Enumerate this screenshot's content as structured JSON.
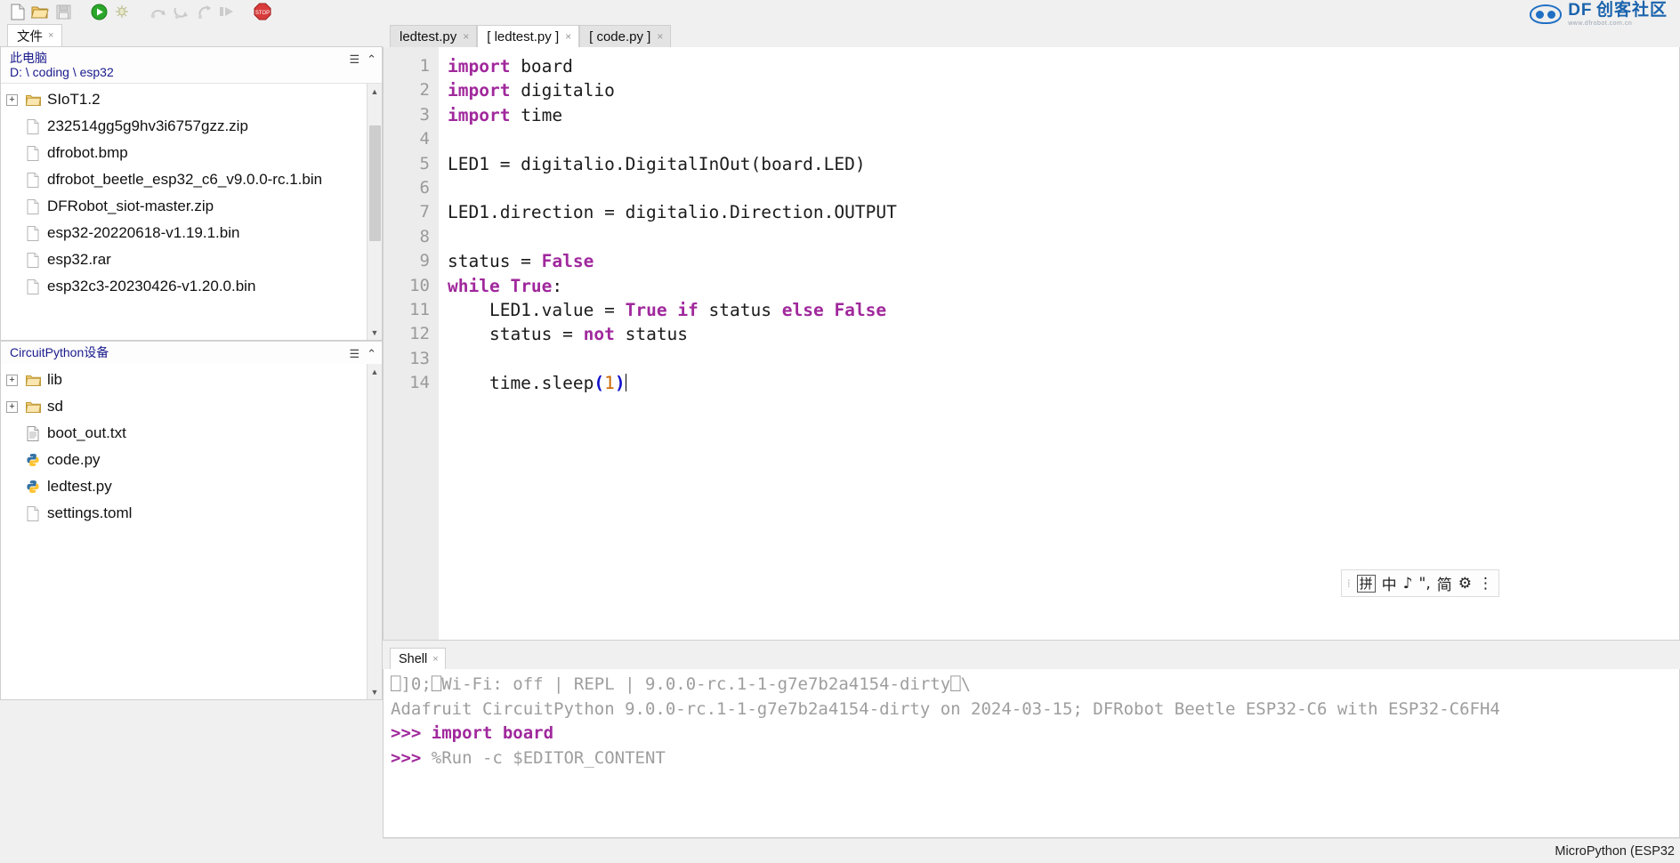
{
  "toolbar": {
    "buttons": [
      {
        "name": "new-file-button",
        "icon": "new-file-icon",
        "label": "New",
        "enabled": true
      },
      {
        "name": "open-file-button",
        "icon": "open-folder-icon",
        "label": "Open",
        "enabled": true
      },
      {
        "name": "save-file-button",
        "icon": "save-disk-icon",
        "label": "Save",
        "enabled": false
      },
      {
        "name": "run-button",
        "icon": "run-play-icon",
        "label": "Run",
        "enabled": true
      },
      {
        "name": "debug-button",
        "icon": "debug-bug-icon",
        "label": "Debug",
        "enabled": false
      },
      {
        "name": "step-over-button",
        "icon": "step-over-icon",
        "label": "Step over",
        "enabled": false
      },
      {
        "name": "step-into-button",
        "icon": "step-into-icon",
        "label": "Step into",
        "enabled": false
      },
      {
        "name": "step-out-button",
        "icon": "step-out-icon",
        "label": "Step out",
        "enabled": false
      },
      {
        "name": "resume-button",
        "icon": "resume-icon",
        "label": "Resume",
        "enabled": false
      },
      {
        "name": "stop-button",
        "icon": "stop-sign-icon",
        "label": "Stop",
        "enabled": true
      }
    ]
  },
  "brand": {
    "title": "DF",
    "subtitle": "创客社区",
    "tagline": "www.dfrobot.com.cn"
  },
  "left_pane": {
    "tab_label": "文件",
    "tab_close": "×",
    "files_panel": {
      "root_label": "此电脑",
      "path_label": "D: \\ coding \\ esp32",
      "menu_icon": "hamburger-menu-icon",
      "collapse_icon": "chevron-up-icon",
      "items": [
        {
          "name": "SIoT1.2",
          "type": "folder",
          "expandable": true
        },
        {
          "name": "232514gg5g9hv3i6757gzz.zip",
          "type": "file",
          "expandable": false
        },
        {
          "name": "dfrobot.bmp",
          "type": "file",
          "expandable": false
        },
        {
          "name": "dfrobot_beetle_esp32_c6_v9.0.0-rc.1.bin",
          "type": "file",
          "expandable": false
        },
        {
          "name": "DFRobot_siot-master.zip",
          "type": "file",
          "expandable": false
        },
        {
          "name": "esp32-20220618-v1.19.1.bin",
          "type": "file",
          "expandable": false
        },
        {
          "name": "esp32.rar",
          "type": "file",
          "expandable": false
        },
        {
          "name": "esp32c3-20230426-v1.20.0.bin",
          "type": "file",
          "expandable": false
        }
      ],
      "scroll_up": "⌃",
      "scroll_down": "⌄"
    },
    "device_panel": {
      "title": "CircuitPython设备",
      "menu_icon": "hamburger-menu-icon",
      "collapse_icon": "chevron-up-icon",
      "items": [
        {
          "name": "lib",
          "type": "folder",
          "expandable": true
        },
        {
          "name": "sd",
          "type": "folder",
          "expandable": true
        },
        {
          "name": "boot_out.txt",
          "type": "textfile",
          "expandable": false
        },
        {
          "name": "code.py",
          "type": "python",
          "expandable": false
        },
        {
          "name": "ledtest.py",
          "type": "python",
          "expandable": false
        },
        {
          "name": "settings.toml",
          "type": "file",
          "expandable": false
        }
      ],
      "scroll_up": "⌃",
      "scroll_down": "⌄"
    }
  },
  "editor": {
    "tabs": [
      {
        "label": "ledtest.py",
        "close": "×",
        "active": false
      },
      {
        "label": "[ ledtest.py ]",
        "close": "×",
        "active": true
      },
      {
        "label": "[ code.py ]",
        "close": "×",
        "active": false
      }
    ],
    "line_numbers": [
      "1",
      "2",
      "3",
      "4",
      "5",
      "6",
      "7",
      "8",
      "9",
      "10",
      "11",
      "12",
      "13",
      "14"
    ],
    "lines": [
      {
        "n": 1,
        "tokens": [
          {
            "t": "import",
            "c": "kw"
          },
          {
            "t": " board",
            "c": ""
          }
        ]
      },
      {
        "n": 2,
        "tokens": [
          {
            "t": "import",
            "c": "kw"
          },
          {
            "t": " digitalio",
            "c": ""
          }
        ]
      },
      {
        "n": 3,
        "tokens": [
          {
            "t": "import",
            "c": "kw"
          },
          {
            "t": " time",
            "c": ""
          }
        ]
      },
      {
        "n": 4,
        "tokens": []
      },
      {
        "n": 5,
        "tokens": [
          {
            "t": "LED1 = digitalio.DigitalInOut(board.LED)",
            "c": ""
          }
        ]
      },
      {
        "n": 6,
        "tokens": []
      },
      {
        "n": 7,
        "tokens": [
          {
            "t": "LED1.direction = digitalio.Direction.OUTPUT",
            "c": ""
          }
        ]
      },
      {
        "n": 8,
        "tokens": []
      },
      {
        "n": 9,
        "tokens": [
          {
            "t": "status = ",
            "c": ""
          },
          {
            "t": "False",
            "c": "kw"
          }
        ]
      },
      {
        "n": 10,
        "tokens": [
          {
            "t": "while",
            "c": "kw"
          },
          {
            "t": " ",
            "c": ""
          },
          {
            "t": "True",
            "c": "kw"
          },
          {
            "t": ":",
            "c": ""
          }
        ]
      },
      {
        "n": 11,
        "tokens": [
          {
            "t": "    LED1.value = ",
            "c": ""
          },
          {
            "t": "True",
            "c": "kw"
          },
          {
            "t": " ",
            "c": ""
          },
          {
            "t": "if",
            "c": "kw"
          },
          {
            "t": " status ",
            "c": ""
          },
          {
            "t": "else",
            "c": "kw"
          },
          {
            "t": " ",
            "c": ""
          },
          {
            "t": "False",
            "c": "kw"
          }
        ]
      },
      {
        "n": 12,
        "tokens": [
          {
            "t": "    status = ",
            "c": ""
          },
          {
            "t": "not",
            "c": "kw"
          },
          {
            "t": " status",
            "c": ""
          }
        ]
      },
      {
        "n": 13,
        "tokens": []
      },
      {
        "n": 14,
        "tokens": [
          {
            "t": "    time.sleep",
            "c": ""
          },
          {
            "t": "(",
            "c": "paren"
          },
          {
            "t": "1",
            "c": "num"
          },
          {
            "t": ")",
            "c": "paren"
          }
        ]
      }
    ]
  },
  "ime_toolbar": {
    "items": [
      "拼",
      "中",
      "♪",
      "\",",
      "简",
      "⚙",
      "⋮"
    ],
    "handle": "drag-handle"
  },
  "shell": {
    "tab_label": "Shell",
    "tab_close": "×",
    "lines": [
      {
        "kind": "out",
        "text": "⎕]0;⎕Wi-Fi: off | REPL | 9.0.0-rc.1-1-g7e7b2a4154-dirty⎕\\"
      },
      {
        "kind": "out",
        "text": "Adafruit CircuitPython 9.0.0-rc.1-1-g7e7b2a4154-dirty on 2024-03-15; DFRobot Beetle ESP32-C6 with ESP32-C6FH4"
      },
      {
        "kind": "prompt",
        "prompt": ">>>",
        "text": "import board",
        "style": "input"
      },
      {
        "kind": "prompt",
        "prompt": ">>>",
        "text": "%Run -c $EDITOR_CONTENT",
        "style": "echo"
      }
    ]
  },
  "status_bar": {
    "interpreter": "MicroPython (ESP32"
  },
  "colors": {
    "keyword": "#a0289c",
    "number": "#cc6600",
    "paren": "#1111cc",
    "gutter_bg": "#ececec",
    "shell_out": "#9e9e9e",
    "tab_active_bg": "#ffffff",
    "path_text": "#1a1a8c",
    "brand_blue": "#1b63ad"
  }
}
